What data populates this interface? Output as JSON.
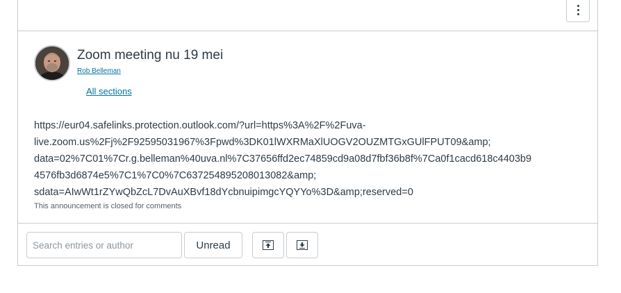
{
  "toolbar": {
    "more_icon": "kebab-menu-icon"
  },
  "announcement": {
    "title": "Zoom meeting nu 19 mei",
    "author": "Rob Belleman",
    "sections_link": "All sections",
    "body_lines": [
      "https://eur04.safelinks.protection.outlook.com/?url=https%3A%2F%2Fuva-",
      "live.zoom.us%2Fj%2F92595031967%3Fpwd%3DK01lWXRMaXlUOGV2OUZMTGxGUlFPUT09&amp;",
      "data=02%7C01%7Cr.g.belleman%40uva.nl%7C37656ffd2ec74859cd9a08d7fbf36b8f%7Ca0f1cacd618c4403b9",
      "4576fb3d6874e5%7C1%7C0%7C637254895208013082&amp;",
      "sdata=AIwWt1rZYwQbZcL7DvAuXBvf18dYcbnuipimgcYQYYo%3D&amp;reserved=0"
    ],
    "closed_note": "This announcement is closed for comments"
  },
  "filters": {
    "search_placeholder": "Search entries or author",
    "search_value": "",
    "unread_label": "Unread",
    "collapse_icon": "collapse-up-icon",
    "expand_icon": "expand-down-icon"
  }
}
